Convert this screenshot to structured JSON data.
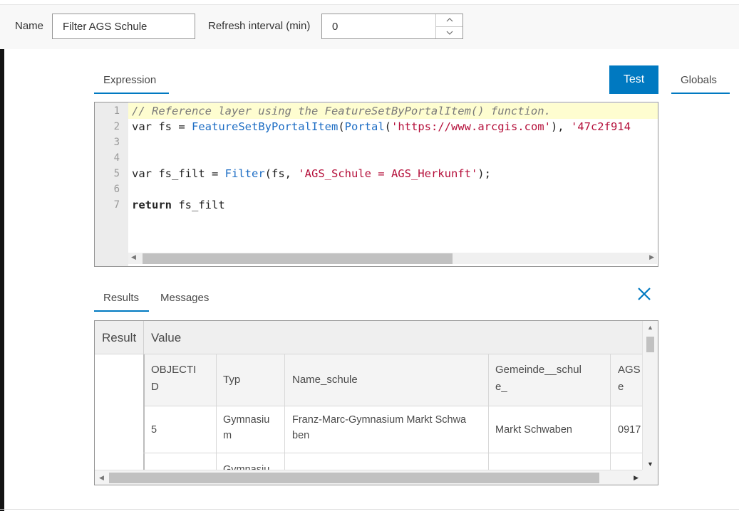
{
  "toolbar": {
    "name_label": "Name",
    "name_value": "Filter AGS Schule",
    "refresh_label": "Refresh interval (min)",
    "refresh_value": "0"
  },
  "tabs": {
    "expression": "Expression",
    "test": "Test",
    "globals": "Globals"
  },
  "editor": {
    "lines": [
      {
        "no": "1",
        "parts": [
          {
            "t": "// Reference layer using the FeatureSetByPortalItem() function.",
            "c": "comment"
          }
        ]
      },
      {
        "no": "2",
        "parts": [
          {
            "t": "var fs = ",
            "c": ""
          },
          {
            "t": "FeatureSetByPortalItem",
            "c": "fn"
          },
          {
            "t": "(",
            "c": ""
          },
          {
            "t": "Portal",
            "c": "fn"
          },
          {
            "t": "(",
            "c": ""
          },
          {
            "t": "'https://www.arcgis.com'",
            "c": "str"
          },
          {
            "t": "), ",
            "c": ""
          },
          {
            "t": "'47c2f914",
            "c": "str"
          }
        ]
      },
      {
        "no": "3",
        "parts": []
      },
      {
        "no": "4",
        "parts": []
      },
      {
        "no": "5",
        "parts": [
          {
            "t": "var fs_filt = ",
            "c": ""
          },
          {
            "t": "Filter",
            "c": "fn"
          },
          {
            "t": "(fs, ",
            "c": ""
          },
          {
            "t": "'AGS_Schule = AGS_Herkunft'",
            "c": "str"
          },
          {
            "t": ");",
            "c": ""
          }
        ]
      },
      {
        "no": "6",
        "parts": []
      },
      {
        "no": "7",
        "parts": [
          {
            "t": "return",
            "c": "kw"
          },
          {
            "t": " fs_filt",
            "c": ""
          }
        ]
      }
    ]
  },
  "results_tabs": {
    "results": "Results",
    "messages": "Messages"
  },
  "results_table": {
    "head_result": "Result",
    "head_value": "Value",
    "columns": [
      {
        "label_l1": "OBJECTI",
        "label_l2": "D"
      },
      {
        "label_l1": "Typ",
        "label_l2": ""
      },
      {
        "label_l1": "Name_schule",
        "label_l2": ""
      },
      {
        "label_l1": "Gemeinde__schul",
        "label_l2": "e_"
      },
      {
        "label_l1": "AGS",
        "label_l2": "e"
      }
    ],
    "rows": [
      {
        "objectid": "5",
        "typ_l1": "Gymnasiu",
        "typ_l2": "m",
        "name_l1": "Franz-Marc-Gymnasium Markt Schwa",
        "name_l2": "ben",
        "gemeinde": "Markt Schwaben",
        "ags": "0917"
      },
      {
        "typ_l1": "Gymnasiu"
      }
    ]
  },
  "icons": {
    "close": "×"
  },
  "colors": {
    "accent": "#0079c1"
  }
}
